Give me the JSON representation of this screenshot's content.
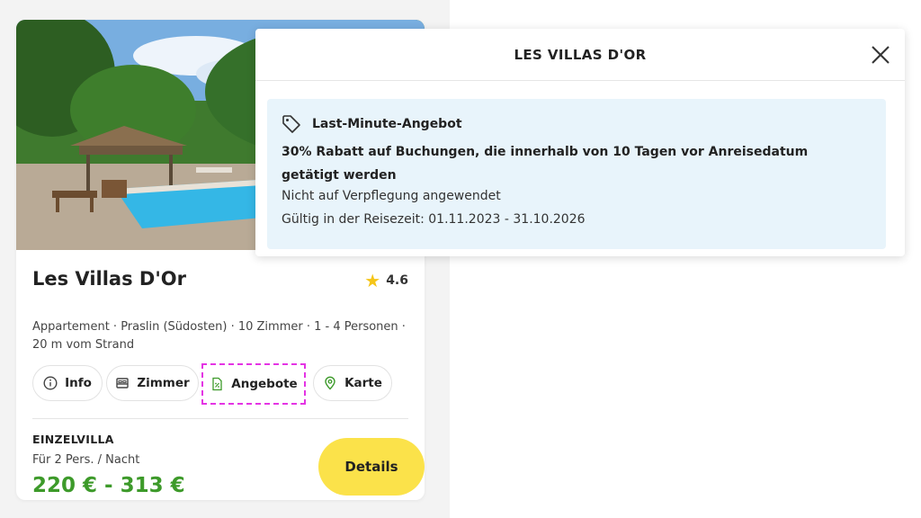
{
  "card": {
    "name": "Les Villas D'Or",
    "rating": "4.6",
    "meta": "Appartement · Praslin (Südosten) · 10 Zimmer · 1 - 4 Personen · 20 m vom Strand",
    "tabs": [
      {
        "label": "Info",
        "icon": "info-icon"
      },
      {
        "label": "Zimmer",
        "icon": "bed-icon"
      },
      {
        "label": "Angebote",
        "icon": "discount-document-icon"
      },
      {
        "label": "Karte",
        "icon": "map-pin-icon"
      }
    ],
    "room_type": "EINZELVILLA",
    "room_sub": "Für 2 Pers. / Nacht",
    "price": "220 € - 313 €",
    "details_label": "Details"
  },
  "popup": {
    "title": "LES VILLAS D'OR",
    "offer_label": "Last-Minute-Angebot",
    "offer_main": "30% Rabatt auf Buchungen, die innerhalb von 10 Tagen vor Anreisedatum getätigt werden",
    "offer_note": "Nicht auf Verpflegung angewendet",
    "offer_valid": "Gültig in der Reisezeit: 01.11.2023 - 31.10.2026"
  },
  "colors": {
    "price": "#3d9a2a",
    "button": "#fbe24a",
    "offer_bg": "#e8f4fb",
    "highlight": "#e434e4",
    "star": "#f5c518"
  }
}
